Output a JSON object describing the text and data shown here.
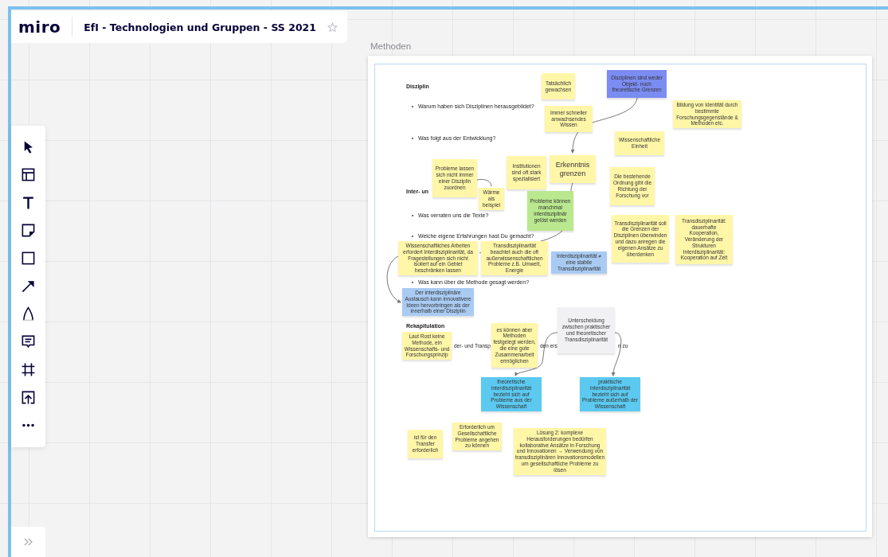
{
  "header": {
    "logo": "miro",
    "board_title": "EfI - Technologien und Gruppen - SS 2021",
    "starred": false
  },
  "frame": {
    "title": "Methoden",
    "texts": [
      {
        "kind": "heading",
        "text": "Disziplin"
      },
      {
        "kind": "bullet",
        "text": "Warum haben sich Disziplinen herausgebildet?"
      },
      {
        "kind": "bullet",
        "text": "Was folgt aus der Entwicklung?"
      },
      {
        "kind": "heading",
        "text": "Inter- un"
      },
      {
        "kind": "bullet",
        "text": "Was verraten uns die Texte?"
      },
      {
        "kind": "bullet",
        "text": "Welche eigene Erfahrungen hast Du gemacht?"
      },
      {
        "kind": "bullet",
        "text": "Was kann über die Methode gesagt werden?"
      },
      {
        "kind": "heading",
        "text": "Rekapitulation"
      },
      {
        "kind": "fragment",
        "text": "der- und Transp"
      },
      {
        "kind": "fragment",
        "text": "den ers"
      },
      {
        "kind": "fragment",
        "text": "n zu"
      }
    ],
    "notes": [
      {
        "kind": "sticky",
        "color": "#fff6a8",
        "text": "Tatsächlich gewachsen"
      },
      {
        "kind": "sticky",
        "color": "#7b8cf2",
        "text": "Disziplinen sind weder Objekt- noch theoretische Grenzen"
      },
      {
        "kind": "sticky",
        "color": "#fff6a8",
        "text": "Immer schneller anwachsendes Wissen"
      },
      {
        "kind": "sticky",
        "color": "#fff6a8",
        "text": "Bildung von Identität durch bestimmte Forschungsgegenstände & Methoden etc."
      },
      {
        "kind": "sticky",
        "color": "#fff6a8",
        "text": "Wissenschaftliche Einheit"
      },
      {
        "kind": "sticky",
        "color": "#fff6a8",
        "text": "Probleme lassen sich nicht immer einer Disziplin zuordnen"
      },
      {
        "kind": "sticky",
        "color": "#fff6a8",
        "text": "Wärme als beispiel"
      },
      {
        "kind": "sticky",
        "color": "#fff6a8",
        "text": "Institutionen sind oft stark spezialisiert"
      },
      {
        "kind": "sticky-large",
        "color": "#fff6a8",
        "text": "Erkenntnis grenzen"
      },
      {
        "kind": "sticky",
        "color": "#b9e88e",
        "text": "Probleme können manchmal interdisziplinär gelöst werden"
      },
      {
        "kind": "sticky",
        "color": "#fff6a8",
        "text": "Die bestehende Ordnung gibt die Richtung der Forschung vor"
      },
      {
        "kind": "sticky",
        "color": "#fff6a8",
        "text": "Wissenschaftliches Arbeiten erfordert Interdisziplinarität, da Fragestellungen sich nicht isoliert auf ein Gebiet beschränken lassen"
      },
      {
        "kind": "sticky",
        "color": "#fff6a8",
        "text": "Transdisziplinarität beachtet auch die oft außerwissenschaftlichen Probleme z.B. Umwelt, Energie"
      },
      {
        "kind": "sticky",
        "color": "#a9cbf3",
        "text": "Interdisziplinarität ≠ eine stabile Transdisziplinarität"
      },
      {
        "kind": "sticky",
        "color": "#fff6a8",
        "text": "Transdisziplinarität soll die Grenzen der Disziplinen überwinden und dazu anregen die eigenen Ansätze zu überdenken"
      },
      {
        "kind": "sticky",
        "color": "#fff6a8",
        "text": "Transdisziplinarität: dauerhafte Kooperation, Veränderung der Strukturen Interdisziplinarität: Kooperation auf Zeit"
      },
      {
        "kind": "sticky",
        "color": "#a9cbf3",
        "text": "Der interdisziplinäre Austausch kann innovativere Ideen hervorbringen als der innerhalb einer Disziplin"
      },
      {
        "kind": "sticky",
        "color": "#fff6a8",
        "text": "Laut Rost keine Methode, ein Wissenschafts- und Forschungsprinzip"
      },
      {
        "kind": "sticky",
        "color": "#fff6a8",
        "text": "es können aber Methoden festgelegt werden, die eine gute Zusammenarbeit ermöglichen"
      },
      {
        "kind": "sticky",
        "color": "#f1f1f3",
        "text": "Unterscheidung zwischen praktischer und theoretischer Transdisziplinarität"
      },
      {
        "kind": "sticky",
        "color": "#5cc9f0",
        "text": "theoretische Interdisziplinarität bezieht sich auf Probleme aus der Wissenschaft"
      },
      {
        "kind": "sticky",
        "color": "#5cc9f0",
        "text": "praktische Interdisziplinarität bezieht sich auf Probleme außerhalb der Wissenschaft"
      },
      {
        "kind": "sticky",
        "color": "#fff6a8",
        "text": "ist für den Transfer erforderlich"
      },
      {
        "kind": "sticky",
        "color": "#fff6a8",
        "text": "Erforderlich um Gesellschaftliche Probleme angehen zu können"
      },
      {
        "kind": "sticky",
        "color": "#fff6a8",
        "text": "Lösung 2: komplexe Herausforderungen bedürfen kollaborative Ansätze in Forschung und Innovationen → Verwendung von transdisziplinären Innovationsmodellen um gesellschaftliche Probleme zu lösen"
      }
    ]
  }
}
